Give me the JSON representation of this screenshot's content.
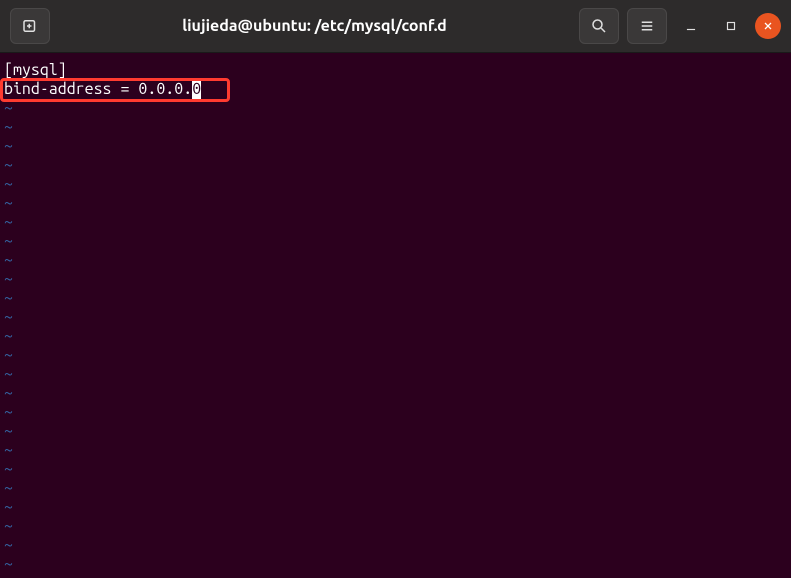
{
  "titlebar": {
    "title": "liujieda@ubuntu: /etc/mysql/conf.d"
  },
  "editor": {
    "lines": [
      "[mysql]",
      "bind-address = 0.0.0."
    ],
    "cursor_char": "0",
    "tilde": "~",
    "tilde_count": 25
  }
}
